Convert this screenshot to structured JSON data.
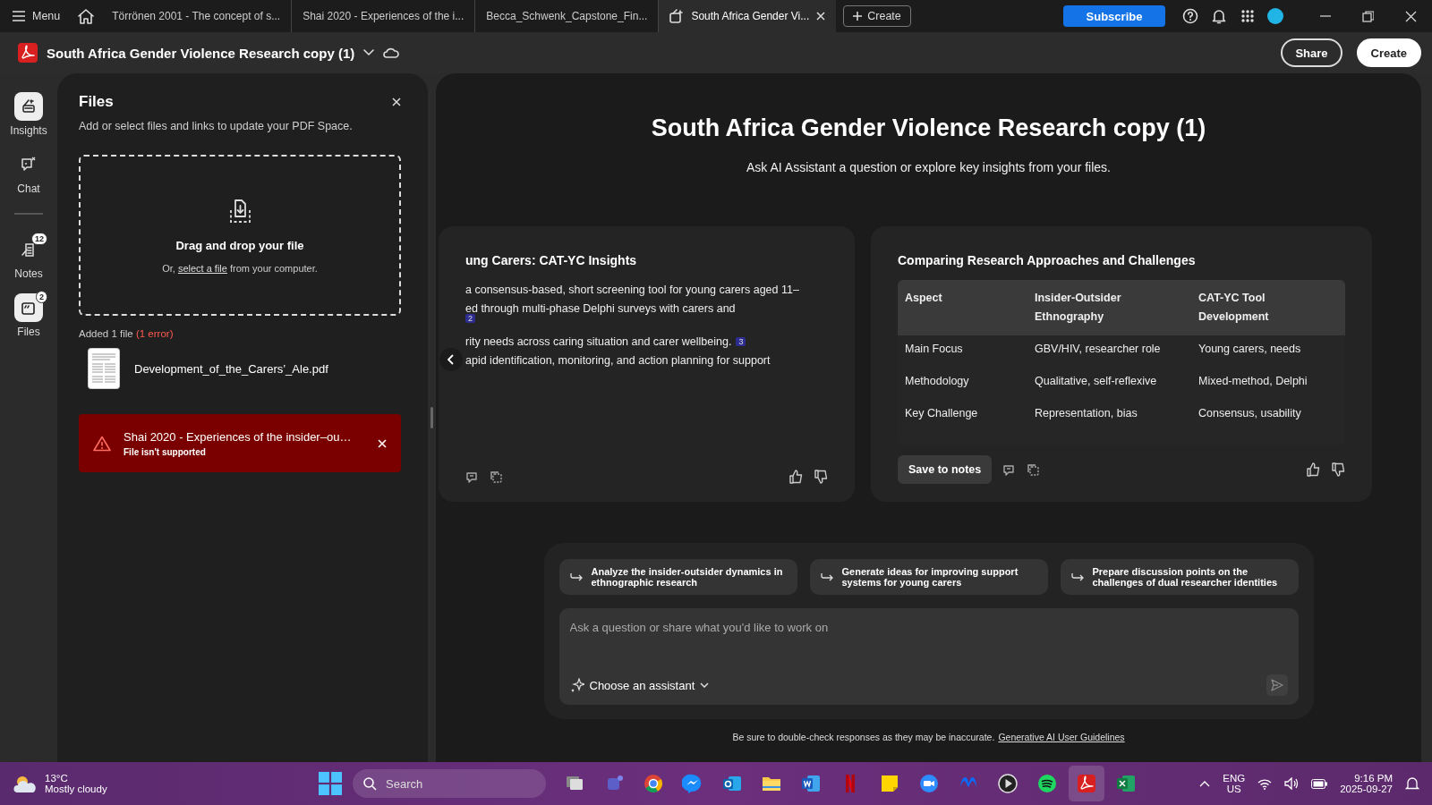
{
  "top_bar": {
    "menu_label": "Menu",
    "tabs": [
      {
        "label": "Törrönen 2001 - The concept of s...",
        "selected": false,
        "kind": "document"
      },
      {
        "label": "Shai 2020 - Experiences of the i...",
        "selected": false,
        "kind": "document"
      },
      {
        "label": "Becca_Schwenk_Capstone_Fin...",
        "selected": false,
        "kind": "document"
      },
      {
        "label": "South Africa Gender Vi...",
        "selected": true,
        "kind": "space"
      }
    ],
    "create_label": "Create",
    "subscribe_label": "Subscribe"
  },
  "title_bar": {
    "title": "South Africa Gender Violence Research copy (1)",
    "share_label": "Share",
    "create_label": "Create"
  },
  "rail": [
    {
      "label": "Insights",
      "kind": "insights",
      "selected": true
    },
    {
      "label": "Chat",
      "kind": "chat",
      "selected": false
    },
    {
      "label": "Notes",
      "kind": "notes",
      "selected": false,
      "badge": "12"
    },
    {
      "label": "Files",
      "kind": "files",
      "selected": true,
      "badge": "2"
    }
  ],
  "files_panel": {
    "title": "Files",
    "subtitle": "Add or select files and links to update your PDF Space.",
    "drop_heading": "Drag and drop your file",
    "hint_prefix": "Or,",
    "hint_link": "select a file",
    "hint_suffix": "from your computer.",
    "added_label": "Added 1 file",
    "error_count": "(1 error)",
    "files": [
      {
        "name": "Development_of_the_Carers’_Ale.pdf"
      }
    ],
    "errors": [
      {
        "title": "Shai 2020 - Experiences of the insider–ou…",
        "message": "File isn't supported"
      }
    ]
  },
  "main": {
    "heading": "South Africa Gender Violence Research copy (1)",
    "subtitle": "Ask AI Assistant a question or explore key insights from your files.",
    "cards": [
      {
        "kind": "text",
        "title": "ung Carers: CAT-YC Insights",
        "items": [
          {
            "kind": "text",
            "text": "a consensus-based, short screening tool for young carers aged 11–"
          },
          {
            "kind": "text",
            "text": "ed through multi-phase Delphi surveys with carers and"
          },
          {
            "kind": "footnote",
            "text": "2"
          },
          {
            "kind": "text",
            "text": "rity needs across caring situation and carer wellbeing.",
            "footnote": "3"
          },
          {
            "kind": "text",
            "text": "apid identification, monitoring, and action planning for support"
          }
        ]
      },
      {
        "kind": "table",
        "title": "Comparing Research Approaches and Challenges",
        "columns": [
          "Aspect",
          "Insider-Outsider Ethnography",
          "CAT-YC Tool Development"
        ],
        "rows": [
          [
            "Main Focus",
            "GBV/HIV, researcher role",
            "Young carers, needs"
          ],
          [
            "Methodology",
            "Qualitative, self-reflexive",
            "Mixed-method, Delphi"
          ],
          [
            "Key Challenge",
            "Representation, bias",
            "Consensus, usability"
          ]
        ],
        "save_label": "Save to notes"
      }
    ],
    "suggestions": [
      "Analyze the insider-outsider dynamics in ethnographic research",
      "Generate ideas for improving support systems for young carers",
      "Prepare discussion points on the challenges of dual researcher identities"
    ],
    "placeholder": "Ask a question or share what you'd like to work on",
    "assistant_label": "Choose an assistant",
    "disclaimer": "Be sure to double-check responses as they may be inaccurate.",
    "guidelines_link": "Generative AI User Guidelines"
  },
  "taskbar": {
    "temperature": "13°C",
    "weather": "Mostly cloudy",
    "search_placeholder": "Search",
    "apps": [
      {
        "kind": "taskview",
        "selected": false
      },
      {
        "kind": "teams",
        "selected": false
      },
      {
        "kind": "chrome",
        "selected": false
      },
      {
        "kind": "messenger",
        "selected": false
      },
      {
        "kind": "outlook",
        "selected": false
      },
      {
        "kind": "explorer",
        "selected": false
      },
      {
        "kind": "word",
        "selected": false
      },
      {
        "kind": "netflix",
        "selected": false
      },
      {
        "kind": "sticky",
        "selected": false
      },
      {
        "kind": "zoom",
        "selected": false
      },
      {
        "kind": "meta",
        "selected": false
      },
      {
        "kind": "player",
        "selected": false
      },
      {
        "kind": "spotify",
        "selected": false
      },
      {
        "kind": "acrobat",
        "selected": true
      },
      {
        "kind": "excel",
        "selected": false
      }
    ],
    "language": "ENG",
    "region": "US",
    "time": "9:16 PM",
    "date": "2025-09-27"
  }
}
